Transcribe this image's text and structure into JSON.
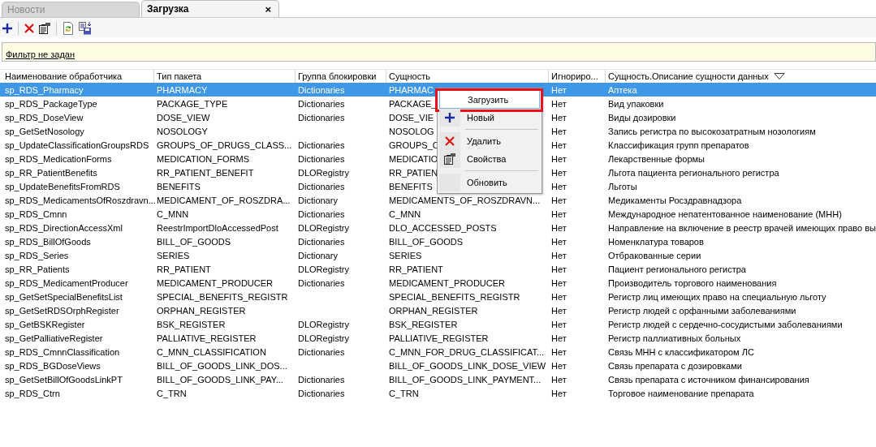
{
  "tabs": [
    {
      "label": "Новости",
      "selected": false
    },
    {
      "label": "Загрузка",
      "selected": true,
      "close": "×"
    }
  ],
  "toolbar": [
    {
      "kind": "add"
    },
    {
      "kind": "sep"
    },
    {
      "kind": "delete"
    },
    {
      "kind": "properties"
    },
    {
      "kind": "sep"
    },
    {
      "kind": "refresh"
    },
    {
      "kind": "export"
    }
  ],
  "filter": {
    "link": "Фильтр не задан"
  },
  "table": {
    "columns": [
      {
        "label": "Наименование обработчика"
      },
      {
        "label": "Тип пакета"
      },
      {
        "label": "Группа блокировки"
      },
      {
        "label": "Сущность"
      },
      {
        "label": "Игнориро..."
      },
      {
        "label": "Сущность.Описание сущности данных",
        "sorted": true
      }
    ],
    "rows": [
      {
        "selected": true,
        "cells": [
          "sp_RDS_Pharmacy",
          "PHARMACY",
          "Dictionaries",
          "PHARMAC",
          "Нет",
          "Аптека"
        ]
      },
      {
        "selected": false,
        "cells": [
          "sp_RDS_PackageType",
          "PACKAGE_TYPE",
          "Dictionaries",
          "PACKAGE_",
          "Нет",
          "Вид упаковки"
        ]
      },
      {
        "selected": false,
        "cells": [
          "sp_RDS_DoseView",
          "DOSE_VIEW",
          "Dictionaries",
          "DOSE_VIE",
          "Нет",
          "Виды дозировки"
        ]
      },
      {
        "selected": false,
        "cells": [
          "sp_GetSetNosology",
          "NOSOLOGY",
          "",
          "NOSOLOG",
          "Нет",
          "Запись регистра по высокозатратным нозологиям"
        ]
      },
      {
        "selected": false,
        "cells": [
          "sp_UpdateClassificationGroupsRDS",
          "GROUPS_OF_DRUGS_CLASS...",
          "Dictionaries",
          "GROUPS_C",
          "Нет",
          "Классификация групп препаратов"
        ]
      },
      {
        "selected": false,
        "cells": [
          "sp_RDS_MedicationForms",
          "MEDICATION_FORMS",
          "Dictionaries",
          "MEDICATIO",
          "Нет",
          "Лекарственные формы"
        ]
      },
      {
        "selected": false,
        "cells": [
          "sp_RR_PatientBenefits",
          "RR_PATIENT_BENEFIT",
          "DLORegistry",
          "RR_PATIEN",
          "Нет",
          "Льгота пациента регионального регистра"
        ]
      },
      {
        "selected": false,
        "cells": [
          "sp_UpdateBenefitsFromRDS",
          "BENEFITS",
          "Dictionaries",
          "BENEFITS",
          "Нет",
          "Льготы"
        ]
      },
      {
        "selected": false,
        "cells": [
          "sp_RDS_MedicamentsOfRoszdravn...",
          "MEDICAMENT_OF_ROSZDRA...",
          "Dictionary",
          "MEDICAMENTS_OF_ROSZDRAVN...",
          "Нет",
          "Медикаменты Росздравнадзора"
        ]
      },
      {
        "selected": false,
        "cells": [
          "sp_RDS_Cmnn",
          "C_MNN",
          "Dictionaries",
          "C_MNN",
          "Нет",
          "Международное непатентованное наименование (МНН)"
        ]
      },
      {
        "selected": false,
        "cells": [
          "sp_RDS_DirectionAccessXml",
          "ReestrImportDloAccessedPost",
          "DLORegistry",
          "DLO_ACCESSED_POSTS",
          "Нет",
          "Направление на включение в реестр врачей имеющих право вы"
        ]
      },
      {
        "selected": false,
        "cells": [
          "sp_RDS_BillOfGoods",
          "BILL_OF_GOODS",
          "Dictionaries",
          "BILL_OF_GOODS",
          "Нет",
          "Номенклатура товаров"
        ]
      },
      {
        "selected": false,
        "cells": [
          "sp_RDS_Series",
          "SERIES",
          "Dictionary",
          "SERIES",
          "Нет",
          "Отбракованные серии"
        ]
      },
      {
        "selected": false,
        "cells": [
          "sp_RR_Patients",
          "RR_PATIENT",
          "DLORegistry",
          "RR_PATIENT",
          "Нет",
          "Пациент регионального регистра"
        ]
      },
      {
        "selected": false,
        "cells": [
          "sp_RDS_MedicamentProducer",
          "MEDICAMENT_PRODUCER",
          "Dictionaries",
          "MEDICAMENT_PRODUCER",
          "Нет",
          "Производитель торгового наименования"
        ]
      },
      {
        "selected": false,
        "cells": [
          "sp_GetSetSpecialBenefitsList",
          "SPECIAL_BENEFITS_REGISTR",
          "",
          "SPECIAL_BENEFITS_REGISTR",
          "Нет",
          "Регистр лиц имеющих право на специальную льготу"
        ]
      },
      {
        "selected": false,
        "cells": [
          "sp_GetSetRDSOrphRegister",
          "ORPHAN_REGISTER",
          "",
          "ORPHAN_REGISTER",
          "Нет",
          "Регистр людей с орфанными заболеваниями"
        ]
      },
      {
        "selected": false,
        "cells": [
          "sp_GetBSKRegister",
          "BSK_REGISTER",
          "DLORegistry",
          "BSK_REGISTER",
          "Нет",
          "Регистр людей с сердечно-сосудистыми заболеваниями"
        ]
      },
      {
        "selected": false,
        "cells": [
          "sp_GetPalliativeRegister",
          "PALLIATIVE_REGISTER",
          "DLORegistry",
          "PALLIATIVE_REGISTER",
          "Нет",
          "Регистр паллиативных больных"
        ]
      },
      {
        "selected": false,
        "cells": [
          "sp_RDS_CmnnClassification",
          "C_MNN_CLASSIFICATION",
          "Dictionaries",
          "C_MNN_FOR_DRUG_CLASSIFICAT...",
          "Нет",
          "Связь МНН с классификатором ЛС"
        ]
      },
      {
        "selected": false,
        "cells": [
          "sp_RDS_BGDoseViews",
          "BILL_OF_GOODS_LINK_DOS...",
          "",
          "BILL_OF_GOODS_LINK_DOSE_VIEW",
          "Нет",
          "Связь препарата с дозировками"
        ]
      },
      {
        "selected": false,
        "cells": [
          "sp_GetSetBillOfGoodsLinkPT",
          "BILL_OF_GOODS_LINK_PAY...",
          "Dictionaries",
          "BILL_OF_GOODS_LINK_PAYMENT...",
          "Нет",
          "Связь препарата с источником финансирования"
        ]
      },
      {
        "selected": false,
        "cells": [
          "sp_RDS_Ctrn",
          "C_TRN",
          "Dictionaries",
          "C_TRN",
          "Нет",
          "Торговое наименование препарата"
        ]
      }
    ]
  },
  "context_menu": {
    "items": [
      {
        "kind": "plain",
        "label": "Загрузить",
        "selected": true,
        "highlighted": true
      },
      {
        "kind": "add",
        "label": "Новый",
        "selected": false
      },
      {
        "kind": "sep"
      },
      {
        "kind": "delete",
        "label": "Удалить",
        "selected": false
      },
      {
        "kind": "properties",
        "label": "Свойства",
        "selected": false
      },
      {
        "kind": "sep"
      },
      {
        "kind": "plain",
        "label": "Обновить",
        "selected": false
      }
    ]
  }
}
